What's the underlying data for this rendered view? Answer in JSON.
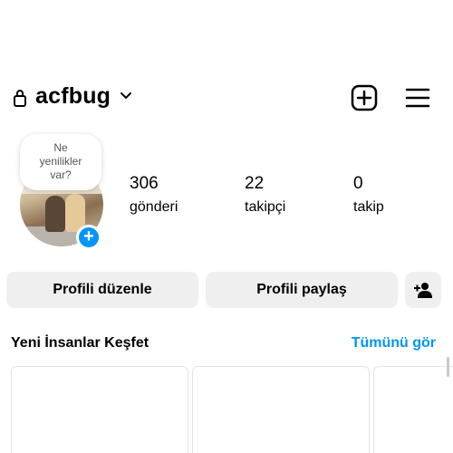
{
  "header": {
    "username": "acfbug",
    "lock_icon": "lock-icon",
    "dropdown_icon": "chevron-down-icon",
    "add_icon": "plus-square-icon",
    "menu_icon": "hamburger-menu-icon"
  },
  "profile": {
    "note_bubble": [
      "Ne",
      "yenilikler",
      "var?"
    ],
    "avatar_icon": "avatar",
    "add_story_icon": "plus-icon"
  },
  "stats": [
    {
      "count": "306",
      "label": "gönderi"
    },
    {
      "count": "22",
      "label": "takipçi"
    },
    {
      "count": "0",
      "label": "takip"
    }
  ],
  "actions": {
    "edit_profile": "Profili düzenle",
    "share_profile": "Profili paylaş",
    "discover_people_icon": "add-person-icon"
  },
  "discover": {
    "title": "Yeni İnsanlar Keşfet",
    "see_all": "Tümünü gör"
  },
  "colors": {
    "accent": "#0095f6",
    "button_bg": "#efefef",
    "text": "#000000"
  }
}
